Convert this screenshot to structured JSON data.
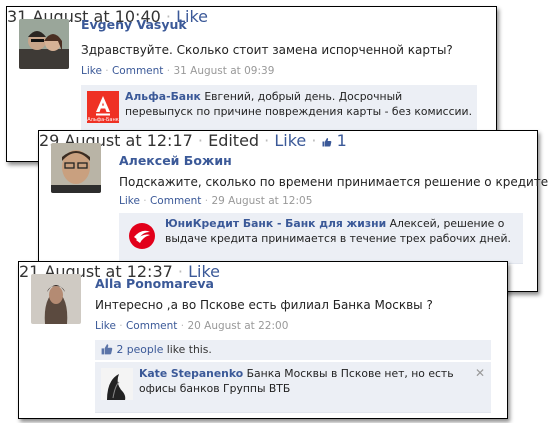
{
  "comments": [
    {
      "author": "Evgeny Vasyuk",
      "text": "Здравствуйте. Сколько стоит замена испорченной карты?",
      "like_label": "Like",
      "comment_label": "Comment",
      "timestamp": "31 August at 09:39",
      "reply": {
        "author": "Альфа-Банк",
        "text": "Евгений, добрый день. Досрочный перевыпуск по причине повреждения карты - без комиссии.",
        "timestamp": "31 August at 10:40",
        "like_label": "Like",
        "logo_text": "Альфа-Банк",
        "logo_color": "#ef3124"
      }
    },
    {
      "author": "Алексей Божин",
      "text": "Подскажите, сколько по времени принимается решение о кредите?",
      "like_label": "Like",
      "comment_label": "Comment",
      "timestamp": "29 August at 12:05",
      "reply": {
        "author": "ЮниКредит Банк - Банк для жизни",
        "text": "Алексей, решение о выдаче кредита принимается в течение трех рабочих дней.",
        "timestamp": "29 August at 12:17",
        "edited_label": "Edited",
        "like_label": "Like",
        "like_count": "1",
        "logo_color": "#e2001a"
      }
    },
    {
      "author": "Alla Ponomareva",
      "text": "Интересно ,а во Пскове есть филиал Банка Москвы ?",
      "like_label": "Like",
      "comment_label": "Comment",
      "timestamp": "20 August at 22:00",
      "likes_bar": {
        "people_link": "2 people",
        "suffix": " like this."
      },
      "reply": {
        "author": "Kate Stepanenko",
        "text": "Банка Москвы в Пскове нет, но есть офисы банков Группы ВТБ",
        "timestamp": "21 August at 12:37",
        "like_label": "Like",
        "close_glyph": "✕"
      }
    }
  ],
  "colors": {
    "link": "#3b5998",
    "meta": "#999999",
    "reply_bg": "#eceff5"
  },
  "icons": {
    "thumb": "thumbs-up-icon",
    "close": "close-icon"
  }
}
